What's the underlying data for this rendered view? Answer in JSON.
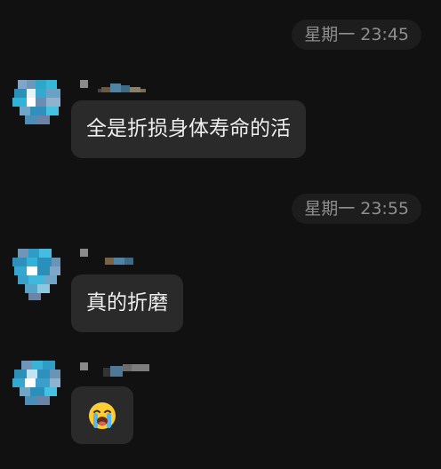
{
  "messages": [
    {
      "time": "星期一 23:45",
      "text": "全是折损身体寿命的活"
    },
    {
      "time": "星期一 23:55",
      "text": "真的折磨"
    },
    {
      "emoji": "loudly-crying-face-emoji"
    }
  ],
  "colors": {
    "background": "#111111",
    "bubble": "#2a2a2a",
    "time_pill": "#1d1d1d",
    "time_text": "#8f8f8f",
    "message_text": "#eeeeee"
  }
}
